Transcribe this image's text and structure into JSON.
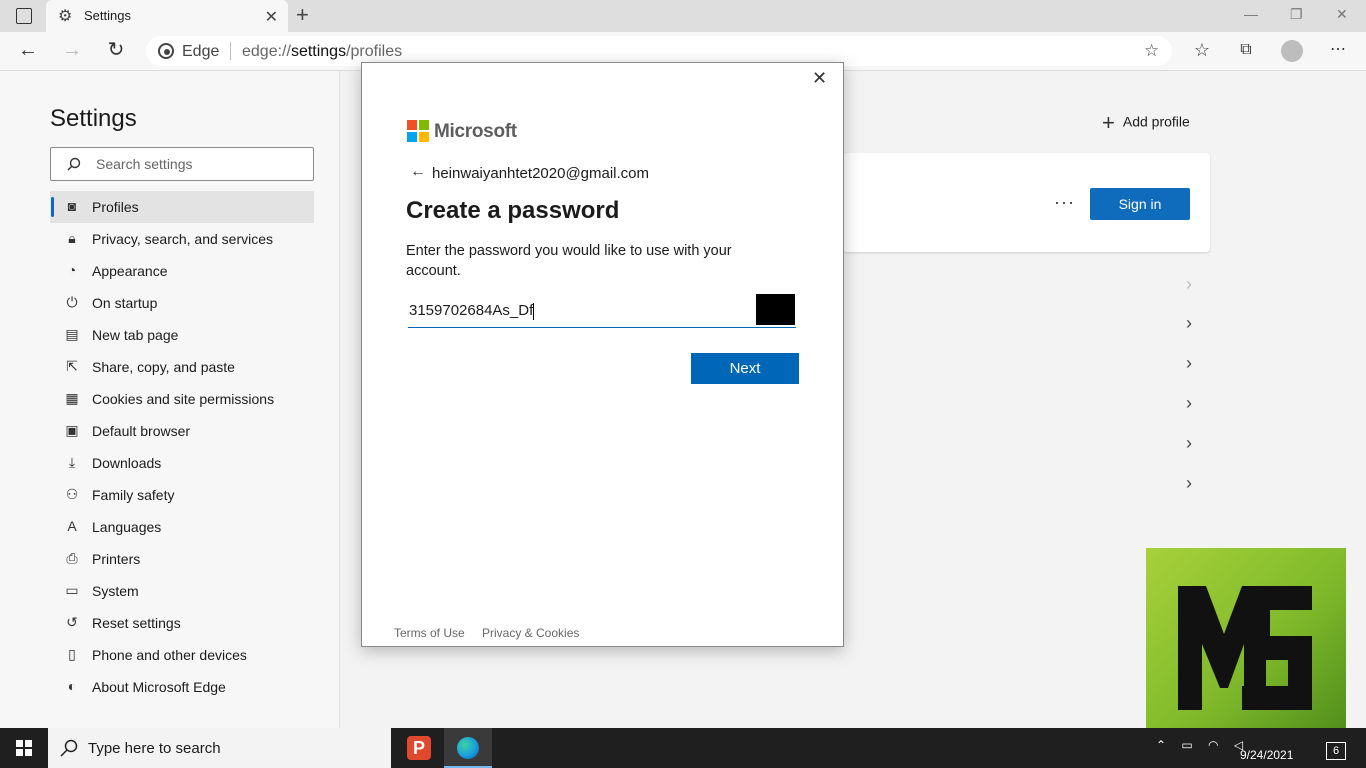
{
  "browser": {
    "tab_title": "Settings",
    "site_label": "Edge",
    "url_prefix": "edge://",
    "url_bold": "settings",
    "url_suffix": "/profiles"
  },
  "sidebar": {
    "title": "Settings",
    "search_placeholder": "Search settings",
    "items": [
      {
        "label": "Profiles",
        "icon": "profile-icon",
        "active": true
      },
      {
        "label": "Privacy, search, and services",
        "icon": "lock-icon"
      },
      {
        "label": "Appearance",
        "icon": "palette-icon"
      },
      {
        "label": "On startup",
        "icon": "power-icon"
      },
      {
        "label": "New tab page",
        "icon": "new-tab-icon"
      },
      {
        "label": "Share, copy, and paste",
        "icon": "share-icon"
      },
      {
        "label": "Cookies and site permissions",
        "icon": "cookie-icon"
      },
      {
        "label": "Default browser",
        "icon": "browser-icon"
      },
      {
        "label": "Downloads",
        "icon": "download-icon"
      },
      {
        "label": "Family safety",
        "icon": "family-icon"
      },
      {
        "label": "Languages",
        "icon": "language-icon"
      },
      {
        "label": "Printers",
        "icon": "printer-icon"
      },
      {
        "label": "System",
        "icon": "laptop-icon"
      },
      {
        "label": "Reset settings",
        "icon": "reset-icon"
      },
      {
        "label": "Phone and other devices",
        "icon": "phone-icon"
      },
      {
        "label": "About Microsoft Edge",
        "icon": "edge-icon"
      }
    ]
  },
  "main": {
    "add_profile_label": "Add profile",
    "more_label": "···",
    "sign_in_label": "Sign in"
  },
  "dialog": {
    "brand": "Microsoft",
    "email": "heinwaiyanhtet2020@gmail.com",
    "title": "Create a password",
    "description": "Enter the password you would like to use with your account.",
    "password_value": "3159702684As_Df",
    "next_label": "Next",
    "footer_terms": "Terms of Use",
    "footer_privacy": "Privacy & Cookies"
  },
  "taskbar": {
    "search_placeholder": "Type here to search",
    "date": "9/24/2021",
    "notification_count": "6"
  },
  "colors": {
    "accent": "#0f6cbd",
    "ms_red": "#f25022",
    "ms_green": "#7fba00",
    "ms_blue": "#00a4ef",
    "ms_yellow": "#ffb900"
  }
}
